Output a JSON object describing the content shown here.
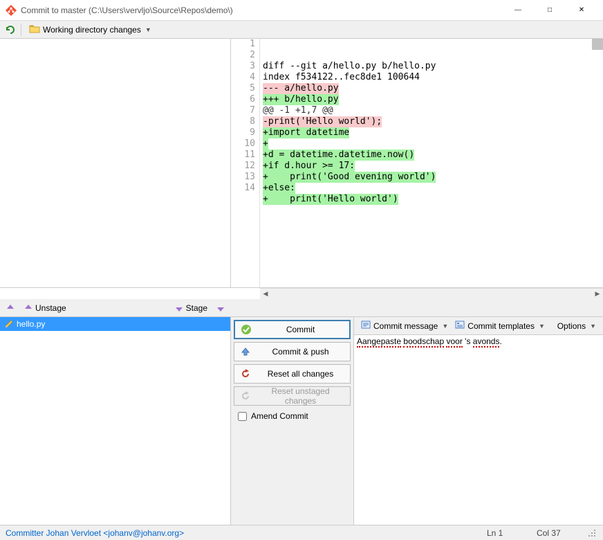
{
  "window": {
    "title": "Commit to master (C:\\Users\\vervljo\\Source\\Repos\\demo\\)"
  },
  "toolbar": {
    "working_dir_label": "Working directory changes"
  },
  "diff": {
    "lines": [
      {
        "n": 1,
        "text": "diff --git a/hello.py b/hello.py",
        "cls": ""
      },
      {
        "n": 2,
        "text": "index f534122..fec8de1 100644",
        "cls": ""
      },
      {
        "n": 3,
        "text": "--- a/hello.py",
        "cls": "removed-file"
      },
      {
        "n": 4,
        "text": "+++ b/hello.py",
        "cls": "added-file"
      },
      {
        "n": 5,
        "text": "@@ -1 +1,7 @@",
        "cls": "hunk"
      },
      {
        "n": 6,
        "text": "-print('Hello world');",
        "cls": "removed-line"
      },
      {
        "n": 7,
        "text": "+import datetime",
        "cls": "added-line"
      },
      {
        "n": 8,
        "text": "+",
        "cls": "added-line"
      },
      {
        "n": 9,
        "text": "+d = datetime.datetime.now()",
        "cls": "added-line"
      },
      {
        "n": 10,
        "text": "+if d.hour >= 17:",
        "cls": "added-line"
      },
      {
        "n": 11,
        "text": "+    print('Good evening world')",
        "cls": "added-line"
      },
      {
        "n": 12,
        "text": "+else:",
        "cls": "added-line"
      },
      {
        "n": 13,
        "text": "+    print('Hello world')",
        "cls": "added-line"
      },
      {
        "n": 14,
        "text": "",
        "cls": ""
      }
    ]
  },
  "stage": {
    "unstage_label": "Unstage",
    "stage_label": "Stage"
  },
  "files": {
    "items": [
      {
        "name": "hello.py"
      }
    ]
  },
  "actions": {
    "commit": "Commit",
    "commit_push": "Commit & push",
    "reset_all": "Reset all changes",
    "reset_unstaged": "Reset unstaged changes",
    "amend": "Amend Commit"
  },
  "message": {
    "commit_message_label": "Commit message",
    "commit_templates_label": "Commit templates",
    "options_label": "Options",
    "text_parts": [
      {
        "t": "Aangepaste",
        "sp": true
      },
      {
        "t": " ",
        "sp": false
      },
      {
        "t": "boodschap",
        "sp": true
      },
      {
        "t": " ",
        "sp": false
      },
      {
        "t": "voor",
        "sp": true
      },
      {
        "t": " 's ",
        "sp": false
      },
      {
        "t": "avonds",
        "sp": true
      },
      {
        "t": ".",
        "sp": false
      }
    ]
  },
  "status": {
    "committer": "Committer Johan Vervloet <johanv@johanv.org>",
    "line": "Ln  1",
    "col": "Col  37"
  }
}
